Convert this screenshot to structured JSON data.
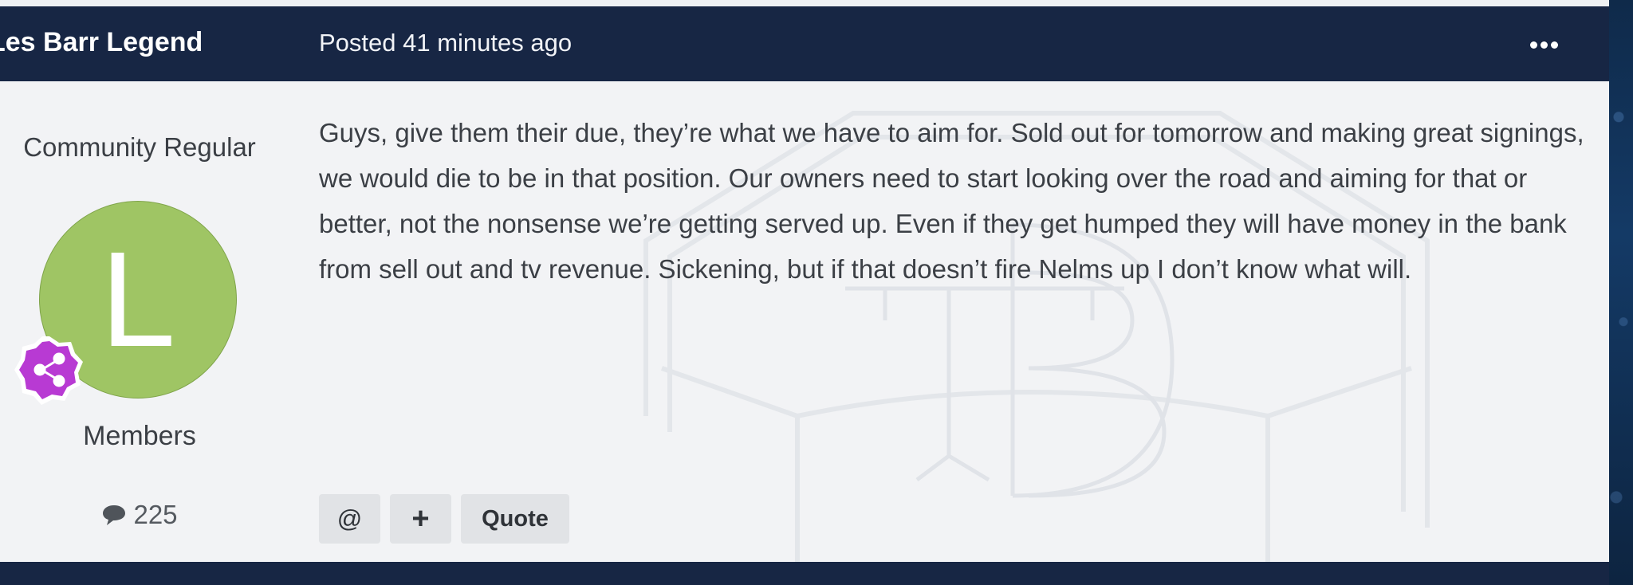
{
  "header": {
    "author": "Les Barr Legend",
    "posted": "Posted 41 minutes ago",
    "more_icon": "ellipsis-icon"
  },
  "author_panel": {
    "rank": "Community Regular",
    "avatar_letter": "L",
    "avatar_color": "#9fc564",
    "badge_icon": "share-network-icon",
    "badge_color": "#b83ad3",
    "group": "Members",
    "post_count": "225",
    "count_icon": "comment-icon"
  },
  "post": {
    "body": "Guys, give them their due, they’re what we have to aim for. Sold out for tomorrow and making great signings, we would die to be in that position. Our owners need to start looking over the road and aiming for that or better, not the  nonsense we’re getting served up. Even if they get humped they will have money in the bank from sell out and tv revenue. Sickening, but if that doesn’t fire Nelms up I don’t know what will."
  },
  "actions": {
    "mention_label": "@",
    "plus_label": "+",
    "quote_label": "Quote"
  },
  "colors": {
    "header_bg": "#172644",
    "post_bg": "#f2f3f5"
  }
}
